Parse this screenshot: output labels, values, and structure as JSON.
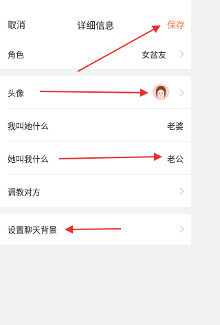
{
  "header": {
    "cancel_label": "取消",
    "title": "详细信息",
    "save_label": "保存"
  },
  "rows": {
    "role": {
      "label": "角色",
      "value": "女盆友"
    },
    "avatar": {
      "label": "头像"
    },
    "i_call_her": {
      "label": "我叫她什么",
      "value": "老婆"
    },
    "she_calls_me": {
      "label": "她叫我什么",
      "value": "老公"
    },
    "train": {
      "label": "调教对方"
    },
    "chat_background": {
      "label": "设置聊天背景"
    }
  },
  "colors": {
    "accent": "#f0774a",
    "annotation_arrow": "#e8302c",
    "background": "#f2f2f2",
    "card": "#ffffff"
  },
  "icons": {
    "avatar": "girl-avatar-icon",
    "chevron": "chevron-right-icon"
  }
}
